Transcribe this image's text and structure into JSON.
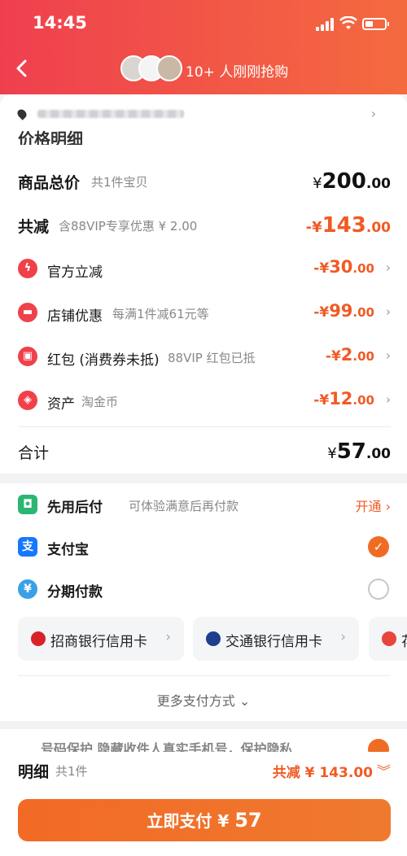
{
  "status": {
    "time": "14:45"
  },
  "header": {
    "buyers_text": "10+ 人刚刚抢购"
  },
  "price_section": {
    "title": "价格明细"
  },
  "rows": {
    "total": {
      "label": "商品总价",
      "sub": "共1件宝贝",
      "currency": "¥",
      "int": "200",
      "dec": ".00"
    },
    "reduce": {
      "label": "共减",
      "sub": "含88VIP专享优惠 ¥ 2.00",
      "currency": "-¥",
      "int": "143",
      "dec": ".00"
    },
    "official": {
      "label": "官方立减",
      "sub": "",
      "currency": "-¥",
      "int": "30",
      "dec": ".00"
    },
    "shop": {
      "label": "店铺优惠",
      "sub": "每满1件减61元等",
      "currency": "-¥",
      "int": "99",
      "dec": ".00"
    },
    "redpacket": {
      "label": "红包 (消费券未抵)",
      "sub": "88VIP 红包已抵",
      "currency": "-¥",
      "int": "2",
      "dec": ".00"
    },
    "assets": {
      "label": "资产",
      "sub": "淘金币",
      "currency": "-¥",
      "int": "12",
      "dec": ".00"
    },
    "sum": {
      "label": "合计",
      "currency": "¥",
      "int": "57",
      "dec": ".00"
    }
  },
  "payment": {
    "later": {
      "label": "先用后付",
      "sub": "可体验满意后再付款",
      "action": "开通 ›"
    },
    "alipay": {
      "label": "支付宝"
    },
    "installment": {
      "label": "分期付款"
    },
    "banks": [
      "招商银行信用卡",
      "交通银行信用卡",
      "花"
    ],
    "more": "更多支付方式 ⌄"
  },
  "footer": {
    "peek_text": "号码保护 隐藏收件人真实手机号，保护隐私",
    "detail_label": "明细",
    "detail_count": "共1件",
    "detail_reduce": "共减 ¥ 143.00",
    "pay_button": "立即支付 ¥",
    "pay_amount": "57"
  },
  "colors": {
    "accent": "#f15a24",
    "header": "#ef3f4f",
    "alipay": "#1677ff",
    "later": "#2bb673"
  }
}
